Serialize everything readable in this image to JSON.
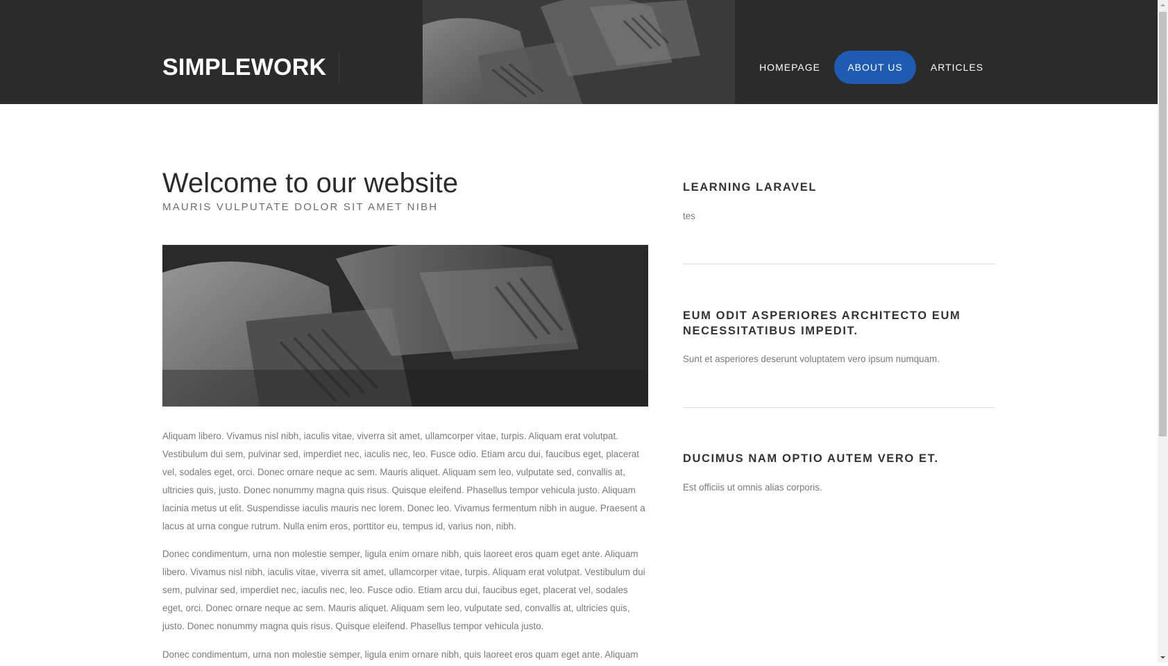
{
  "header": {
    "logo": "SIMPLEWORK",
    "photo_icon": "ethernet-cables-photo",
    "nav": [
      {
        "label": "HOMEPAGE",
        "active": false
      },
      {
        "label": "ABOUT US",
        "active": true
      },
      {
        "label": "ARTICLES",
        "active": false
      }
    ],
    "colors": {
      "header_bg": "#2b2b2b",
      "active_nav_bg": "#1f5bb0"
    }
  },
  "main": {
    "title": "Welcome to our website",
    "subtitle": "MAURIS VULPUTATE DOLOR SIT AMET NIBH",
    "hero_icon": "ethernet-cables-photo",
    "paragraphs": [
      "Aliquam libero. Vivamus nisl nibh, iaculis vitae, viverra sit amet, ullamcorper vitae, turpis. Aliquam erat volutpat. Vestibulum dui sem, pulvinar sed, imperdiet nec, iaculis nec, leo. Fusce odio. Etiam arcu dui, faucibus eget, placerat vel, sodales eget, orci. Donec ornare neque ac sem. Mauris aliquet. Aliquam sem leo, vulputate sed, convallis at, ultricies quis, justo. Donec nonummy magna quis risus. Quisque eleifend. Phasellus tempor vehicula justo. Aliquam lacinia metus ut elit. Suspendisse iaculis mauris nec lorem. Donec leo. Vivamus fermentum nibh in augue. Praesent a lacus at urna congue rutrum. Nulla enim eros, porttitor eu, tempus id, varius non, nibh.",
      "Donec condimentum, urna non molestie semper, ligula enim ornare nibh, quis laoreet eros quam eget ante. Aliquam libero. Vivamus nisl nibh, iaculis vitae, viverra sit amet, ullamcorper vitae, turpis. Aliquam erat volutpat. Vestibulum dui sem, pulvinar sed, imperdiet nec, iaculis nec, leo. Fusce odio. Etiam arcu dui, faucibus eget, placerat vel, sodales eget, orci. Donec ornare neque ac sem. Mauris aliquet. Aliquam sem leo, vulputate sed, convallis at, ultricies quis, justo. Donec nonummy magna quis risus. Quisque eleifend. Phasellus tempor vehicula justo.",
      "Donec condimentum, urna non molestie semper, ligula enim ornare nibh, quis laoreet eros quam eget ante. Aliquam"
    ]
  },
  "sidebar": {
    "sections": [
      {
        "title": "LEARNING LARAVEL",
        "text": "tes"
      },
      {
        "title": "EUM ODIT ASPERIORES ARCHITECTO EUM NECESSITATIBUS IMPEDIT.",
        "text": "Sunt et asperiores deserunt voluptatem vero ipsum numquam."
      },
      {
        "title": "DUCIMUS NAM OPTIO AUTEM VERO ET.",
        "text": "Est officiis ut omnis alias corporis."
      }
    ]
  },
  "scrollbar": {
    "up_icon": "arrow-up-icon",
    "down_icon": "arrow-down-icon"
  }
}
